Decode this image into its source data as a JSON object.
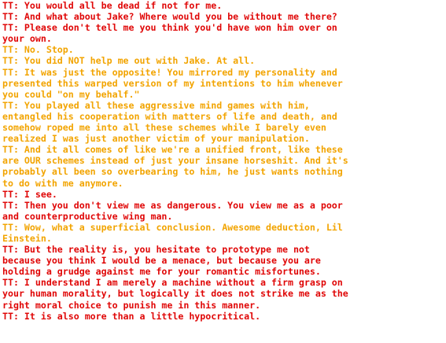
{
  "colors": {
    "red": "#e00707",
    "orange": "#f2a400"
  },
  "lines": [
    {
      "text": "TT: You would all be dead if not for me.",
      "color": "red"
    },
    {
      "text": "TT: And what about Jake? Where would you be without me there?",
      "color": "red"
    },
    {
      "text": "TT: Please don't tell me you think you'd have won him over on",
      "color": "red"
    },
    {
      "text": "your own.",
      "color": "red"
    },
    {
      "text": "TT: No. Stop.",
      "color": "orange"
    },
    {
      "text": "TT: You did NOT help me out with Jake. At all.",
      "color": "orange"
    },
    {
      "text": "TT: It was just the opposite! You mirrored my personality and",
      "color": "orange"
    },
    {
      "text": "presented this warped version of my intentions to him whenever",
      "color": "orange"
    },
    {
      "text": "you could \"on my behalf.\"",
      "color": "orange"
    },
    {
      "text": "TT: You played all these aggressive mind games with him,",
      "color": "orange"
    },
    {
      "text": "entangled his cooperation with matters of life and death, and",
      "color": "orange"
    },
    {
      "text": "somehow roped me into all these schemes while I barely even",
      "color": "orange"
    },
    {
      "text": "realized I was just another victim of your manipulation.",
      "color": "orange"
    },
    {
      "text": "TT: And it all comes of like we're a unified front, like these",
      "color": "orange"
    },
    {
      "text": "are OUR schemes instead of just your insane horseshit. And it's",
      "color": "orange"
    },
    {
      "text": "probably all been so overbearing to him, he just wants nothing",
      "color": "orange"
    },
    {
      "text": "to do with me anymore.",
      "color": "orange"
    },
    {
      "text": "TT: I see.",
      "color": "red"
    },
    {
      "text": "TT: Then you don't view me as dangerous. You view me as a poor",
      "color": "red"
    },
    {
      "text": "and counterproductive wing man.",
      "color": "red"
    },
    {
      "text": "TT: Wow, what a superficial conclusion. Awesome deduction, Lil",
      "color": "orange"
    },
    {
      "text": "Einstein.",
      "color": "orange"
    },
    {
      "text": "TT: But the reality is, you hesitate to prototype me not",
      "color": "red"
    },
    {
      "text": "because you think I would be a menace, but because you are",
      "color": "red"
    },
    {
      "text": "holding a grudge against me for your romantic misfortunes.",
      "color": "red"
    },
    {
      "text": "TT: I understand I am merely a machine without a firm grasp on",
      "color": "red"
    },
    {
      "text": "your human morality, but logically it does not strike me as the",
      "color": "red"
    },
    {
      "text": "right moral choice to punish me in this manner.",
      "color": "red"
    },
    {
      "text": "TT: It is also more than a little hypocritical.",
      "color": "red"
    }
  ]
}
